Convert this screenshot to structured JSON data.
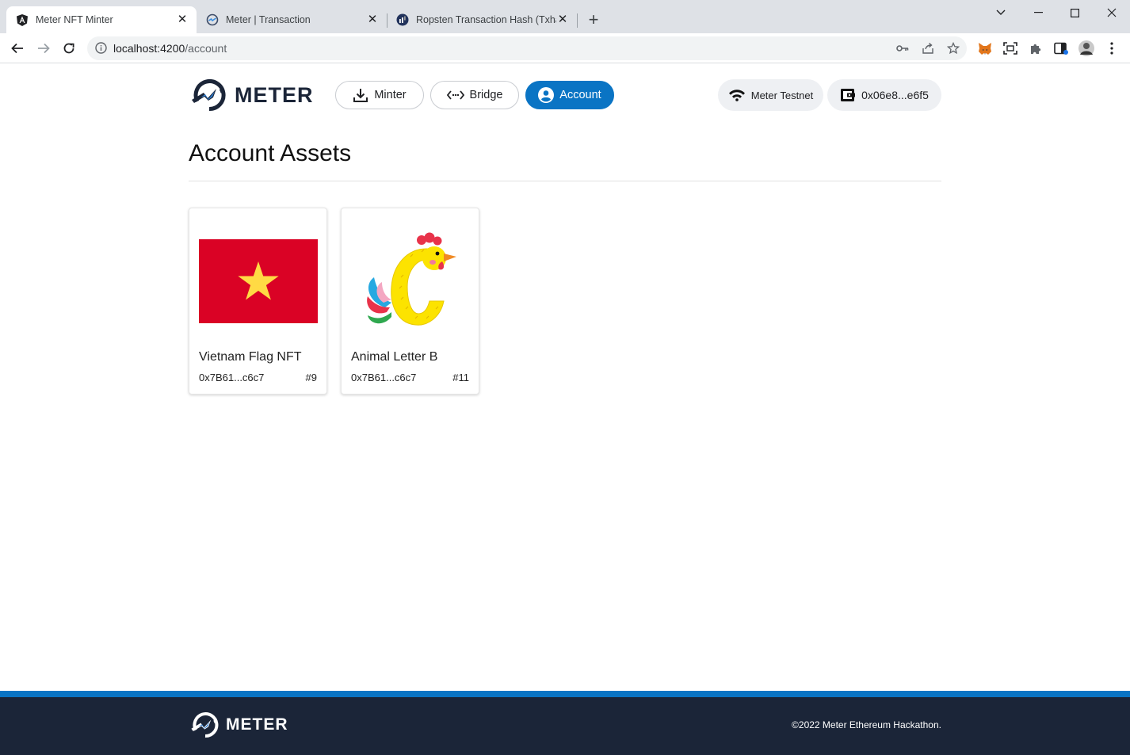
{
  "browser": {
    "tabs": [
      {
        "title": "Meter NFT Minter",
        "active": true,
        "icon": "angular-icon"
      },
      {
        "title": "Meter | Transaction",
        "active": false,
        "icon": "meter-icon"
      },
      {
        "title": "Ropsten Transaction Hash (Txhash)",
        "active": false,
        "icon": "etherscan-icon"
      }
    ],
    "url_host": "localhost:4200",
    "url_path": "/account"
  },
  "header": {
    "logo_text": "METER",
    "nav": [
      {
        "label": "Minter",
        "icon": "download-icon",
        "active": false
      },
      {
        "label": "Bridge",
        "icon": "bridge-icon",
        "active": false
      },
      {
        "label": "Account",
        "icon": "account-circle-icon",
        "active": true
      }
    ],
    "network_label": "Meter Testnet",
    "wallet_label": "0x06e8...e6f5"
  },
  "main": {
    "title": "Account Assets",
    "assets": [
      {
        "name": "Vietnam Flag NFT",
        "address": "0x7B61...c6c7",
        "token_id": "#9"
      },
      {
        "name": "Animal Letter B",
        "address": "0x7B61...c6c7",
        "token_id": "#11"
      }
    ]
  },
  "footer": {
    "logo_text": "METER",
    "copyright": "©2022 Meter Ethereum Hackathon."
  },
  "colors": {
    "accent": "#0a74c4",
    "navy": "#1b2538",
    "flag_red": "#da0225",
    "flag_star": "#ffda44"
  }
}
